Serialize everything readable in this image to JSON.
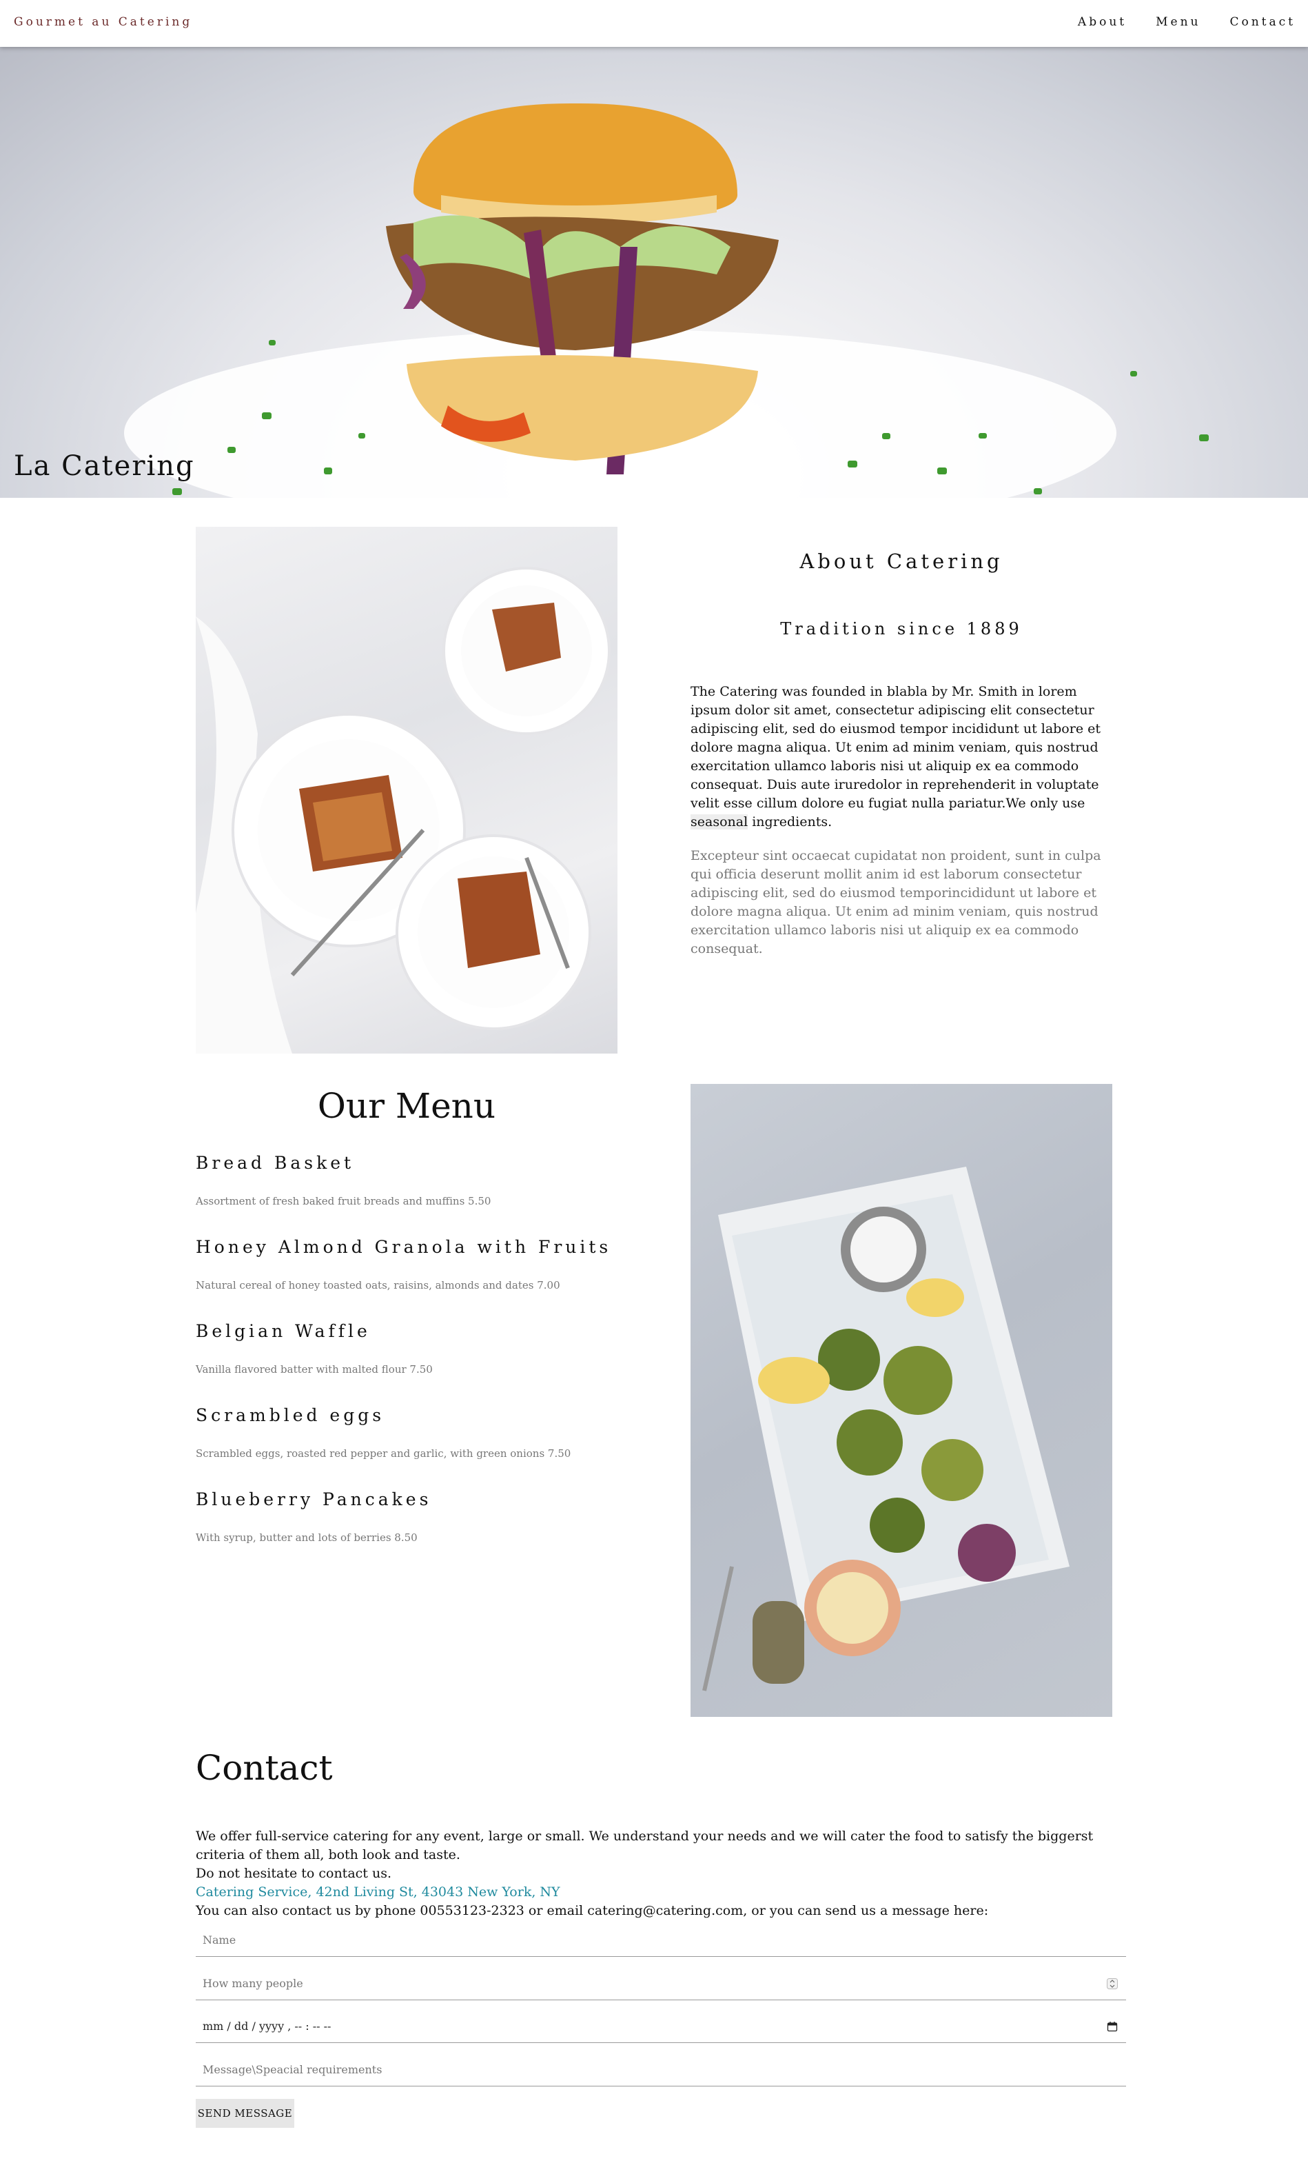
{
  "navbar": {
    "brand": "Gourmet au Catering",
    "links": [
      "About",
      "Menu",
      "Contact"
    ]
  },
  "hero": {
    "title": "La Catering"
  },
  "about": {
    "title": "About Catering",
    "subtitle": "Tradition since 1889",
    "paragraph1_before": "The Catering was founded in blabla by Mr. Smith in lorem ipsum dolor sit amet, consectetur adipiscing elit consectetur adipiscing elit, sed do eiusmod tempor incididunt ut labore et dolore magna aliqua. Ut enim ad minim veniam, quis nostrud exercitation ullamco laboris nisi ut aliquip ex ea commodo consequat. Duis aute iruredolor in reprehenderit in voluptate velit esse cillum dolore eu fugiat nulla pariatur.We only use ",
    "paragraph1_highlight": "seasonal",
    "paragraph1_after": " ingredients.",
    "paragraph2": "Excepteur sint occaecat cupidatat non proident, sunt in culpa qui officia deserunt mollit anim id est laborum consectetur adipiscing elit, sed do eiusmod temporincididunt ut labore et dolore magna aliqua. Ut enim ad minim veniam, quis nostrud exercitation ullamco laboris nisi ut aliquip ex ea commodo consequat."
  },
  "menu": {
    "title": "Our Menu",
    "items": [
      {
        "name": "Bread Basket",
        "desc": "Assortment of fresh baked fruit breads and muffins 5.50"
      },
      {
        "name": "Honey Almond Granola with Fruits",
        "desc": "Natural cereal of honey toasted oats, raisins, almonds and dates 7.00"
      },
      {
        "name": "Belgian Waffle",
        "desc": "Vanilla flavored batter with malted flour 7.50"
      },
      {
        "name": "Scrambled eggs",
        "desc": "Scrambled eggs, roasted red pepper and garlic, with green onions 7.50"
      },
      {
        "name": "Blueberry Pancakes",
        "desc": "With syrup, butter and lots of berries 8.50"
      }
    ]
  },
  "contact": {
    "title": "Contact",
    "line1": "We offer full-service catering for any event, large or small. We understand your needs and we will cater the food to satisfy the biggerst criteria of them all, both look and taste.",
    "line2": "Do not hesitate to contact us.",
    "address": "Catering Service, 42nd Living St, 43043 New York, NY",
    "line3": "You can also contact us by phone 00553123-2323 or email catering@catering.com, or you can send us a message here:",
    "form": {
      "name_placeholder": "Name",
      "people_placeholder": "How many people",
      "date_placeholder": "mm / dd / yyyy ,  -- : --   --",
      "message_placeholder": "Message\\Speacial requirements",
      "send_label": "SEND MESSAGE"
    }
  },
  "colors": {
    "brand": "#6b2a2a",
    "link": "#1f8a9e",
    "muted_text": "#777777"
  }
}
